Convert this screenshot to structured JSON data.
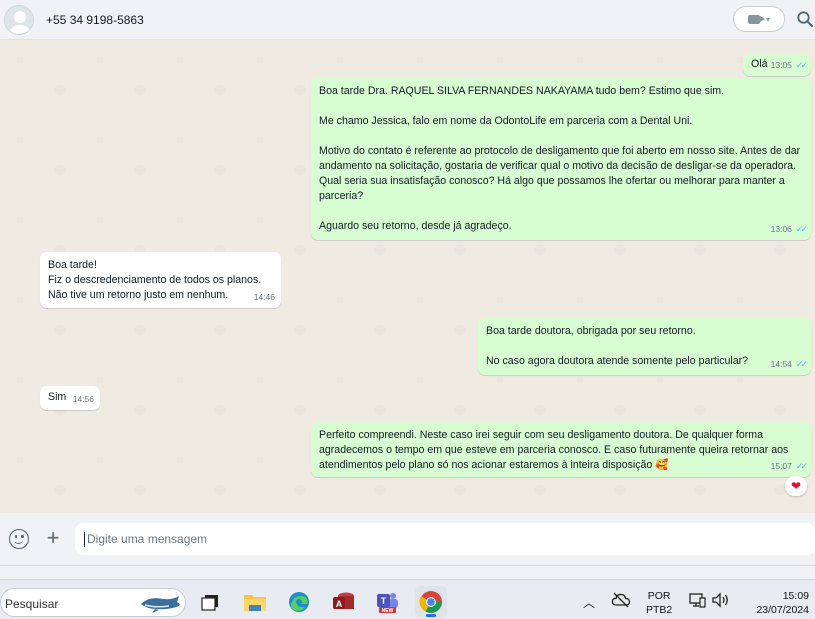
{
  "header": {
    "contact_name": "+55 34 9198-5863"
  },
  "messages": [
    {
      "direction": "out",
      "text": "Olá",
      "time": "13:05"
    },
    {
      "direction": "out",
      "text": "Boa tarde Dra. RAQUEL SILVA FERNANDES NAKAYAMA tudo bem? Estimo que sim.\n\nMe chamo Jessica, falo em nome da OdontoLife em parceria com a Dental Uni.\n\nMotivo do contato é referente ao protocolo de desligamento que foi aberto em nosso site. Antes de dar andamento na solicitação, gostaria de verificar qual o motivo da decisão de desligar-se da operadora. Qual seria sua insatisfação conosco? Há algo que possamos lhe ofertar ou melhorar para manter a parceria?\n\nAguardo seu retorno, desde já agradeço.",
      "time": "13:06"
    },
    {
      "direction": "in",
      "text": "Boa tarde!\nFiz o descredenciamento de todos os planos.\nNão tive um retorno justo em nenhum.",
      "time": "14:46"
    },
    {
      "direction": "out",
      "text": "Boa tarde doutora, obrigada por seu retorno.\n\nNo caso agora doutora atende somente pelo particular?",
      "time": "14:54"
    },
    {
      "direction": "in",
      "text": "Sim",
      "time": "14:56"
    },
    {
      "direction": "out",
      "text": "Perfeito compreendi. Neste caso irei seguir com seu desligamento doutora. De qualquer forma agradecemos o tempo em que esteve em parceria conosco. E caso futuramente queira retornar aos atendimentos pelo plano só nos acionar estaremos à inteira disposição 🥰",
      "time": "15:07",
      "reaction": "❤"
    }
  ],
  "compose": {
    "placeholder": "Digite uma mensagem"
  },
  "taskbar": {
    "search_placeholder": "Pesquisar",
    "language": "POR",
    "keyboard_layout": "PTB2",
    "time": "15:09",
    "date": "23/07/2024"
  },
  "icons": {
    "video": "video-call-icon",
    "search": "search-icon",
    "emoji": "emoji-icon",
    "attach": "plus-icon",
    "read_receipt": "double-check-icon"
  },
  "colors": {
    "outgoing_bubble": "#d9fdd3",
    "incoming_bubble": "#ffffff",
    "chat_background": "#efeae2",
    "read_tick": "#53bdeb"
  }
}
